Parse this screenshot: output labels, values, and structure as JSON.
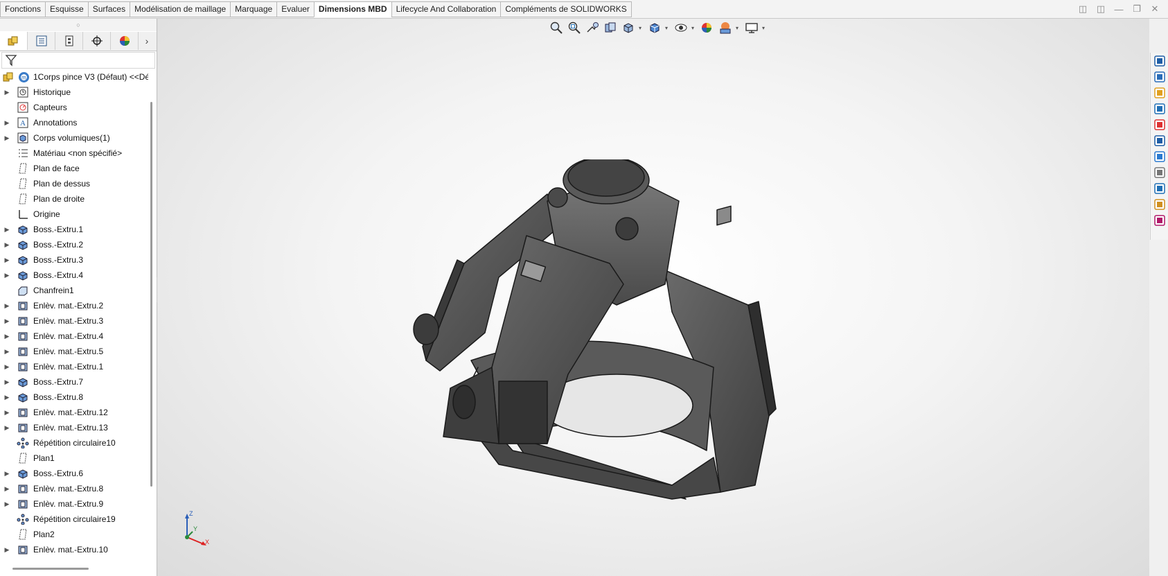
{
  "ribbon": {
    "tabs": [
      {
        "label": "Fonctions",
        "active": false
      },
      {
        "label": "Esquisse",
        "active": false
      },
      {
        "label": "Surfaces",
        "active": false
      },
      {
        "label": "Modélisation de maillage",
        "active": false
      },
      {
        "label": "Marquage",
        "active": false
      },
      {
        "label": "Evaluer",
        "active": false
      },
      {
        "label": "Dimensions MBD",
        "active": true
      },
      {
        "label": "Lifecycle And Collaboration",
        "active": false
      },
      {
        "label": "Compléments de SOLIDWORKS",
        "active": false
      }
    ]
  },
  "window_controls": [
    "restore-left-icon",
    "restore-right-icon",
    "minimize-icon",
    "maximize-icon",
    "close-icon"
  ],
  "panel_tabs": [
    "featuremanager-icon",
    "propertymanager-icon",
    "configurationmanager-icon",
    "dimxpert-icon",
    "displaymanager-icon"
  ],
  "tree": {
    "root": {
      "label": "1Corps pince V3 (Défaut) <<Dé"
    },
    "nodes": [
      {
        "label": "Historique",
        "icon": "history-icon",
        "expandable": true
      },
      {
        "label": "Capteurs",
        "icon": "sensor-icon",
        "expandable": false
      },
      {
        "label": "Annotations",
        "icon": "annotations-icon",
        "expandable": true
      },
      {
        "label": "Corps volumiques(1)",
        "icon": "solid-bodies-icon",
        "expandable": true
      },
      {
        "label": "Matériau <non spécifié>",
        "icon": "material-icon",
        "expandable": false
      },
      {
        "label": "Plan de face",
        "icon": "plane-icon",
        "expandable": false
      },
      {
        "label": "Plan de dessus",
        "icon": "plane-icon",
        "expandable": false
      },
      {
        "label": "Plan de droite",
        "icon": "plane-icon",
        "expandable": false
      },
      {
        "label": "Origine",
        "icon": "origin-icon",
        "expandable": false
      },
      {
        "label": "Boss.-Extru.1",
        "icon": "boss-extrude-icon",
        "expandable": true
      },
      {
        "label": "Boss.-Extru.2",
        "icon": "boss-extrude-icon",
        "expandable": true
      },
      {
        "label": "Boss.-Extru.3",
        "icon": "boss-extrude-icon",
        "expandable": true
      },
      {
        "label": "Boss.-Extru.4",
        "icon": "boss-extrude-icon",
        "expandable": true
      },
      {
        "label": "Chanfrein1",
        "icon": "chamfer-icon",
        "expandable": false
      },
      {
        "label": "Enlèv. mat.-Extru.2",
        "icon": "cut-extrude-icon",
        "expandable": true
      },
      {
        "label": "Enlèv. mat.-Extru.3",
        "icon": "cut-extrude-icon",
        "expandable": true
      },
      {
        "label": "Enlèv. mat.-Extru.4",
        "icon": "cut-extrude-icon",
        "expandable": true
      },
      {
        "label": "Enlèv. mat.-Extru.5",
        "icon": "cut-extrude-icon",
        "expandable": true
      },
      {
        "label": "Enlèv. mat.-Extru.1",
        "icon": "cut-extrude-icon",
        "expandable": true
      },
      {
        "label": "Boss.-Extru.7",
        "icon": "boss-extrude-icon",
        "expandable": true
      },
      {
        "label": "Boss.-Extru.8",
        "icon": "boss-extrude-icon",
        "expandable": true
      },
      {
        "label": "Enlèv. mat.-Extru.12",
        "icon": "cut-extrude-icon",
        "expandable": true
      },
      {
        "label": "Enlèv. mat.-Extru.13",
        "icon": "cut-extrude-icon",
        "expandable": true
      },
      {
        "label": "Répétition circulaire10",
        "icon": "circular-pattern-icon",
        "expandable": false
      },
      {
        "label": "Plan1",
        "icon": "plane-icon",
        "expandable": false
      },
      {
        "label": "Boss.-Extru.6",
        "icon": "boss-extrude-icon",
        "expandable": true
      },
      {
        "label": "Enlèv. mat.-Extru.8",
        "icon": "cut-extrude-icon",
        "expandable": true
      },
      {
        "label": "Enlèv. mat.-Extru.9",
        "icon": "cut-extrude-icon",
        "expandable": true
      },
      {
        "label": "Répétition circulaire19",
        "icon": "circular-pattern-icon",
        "expandable": false
      },
      {
        "label": "Plan2",
        "icon": "plane-icon",
        "expandable": false
      },
      {
        "label": "Enlèv. mat.-Extru.10",
        "icon": "cut-extrude-icon",
        "expandable": true
      }
    ]
  },
  "heads_up_toolbar": [
    "zoom-to-fit-icon",
    "zoom-to-area-icon",
    "previous-view-icon",
    "section-view-icon",
    "view-orientation-icon",
    "display-style-icon",
    "hide-show-items-icon",
    "edit-appearance-icon",
    "apply-scene-icon",
    "view-settings-icon"
  ],
  "triad_labels": {
    "z": "Z",
    "y": "Y",
    "x": "X"
  },
  "task_pane": [
    "solidworks-resources-icon",
    "design-library-icon",
    "file-explorer-icon",
    "view-palette-icon",
    "appearances-scenes-icon",
    "custom-properties-icon",
    "solidworks-forum-icon",
    "3d-content-central-icon",
    "toolbox-icon",
    "costing-icon",
    "3dexperience-icon"
  ],
  "colors": {
    "accent": "#1f6fb5",
    "model_fill": "#505050",
    "model_edge": "#1a1a1a"
  }
}
